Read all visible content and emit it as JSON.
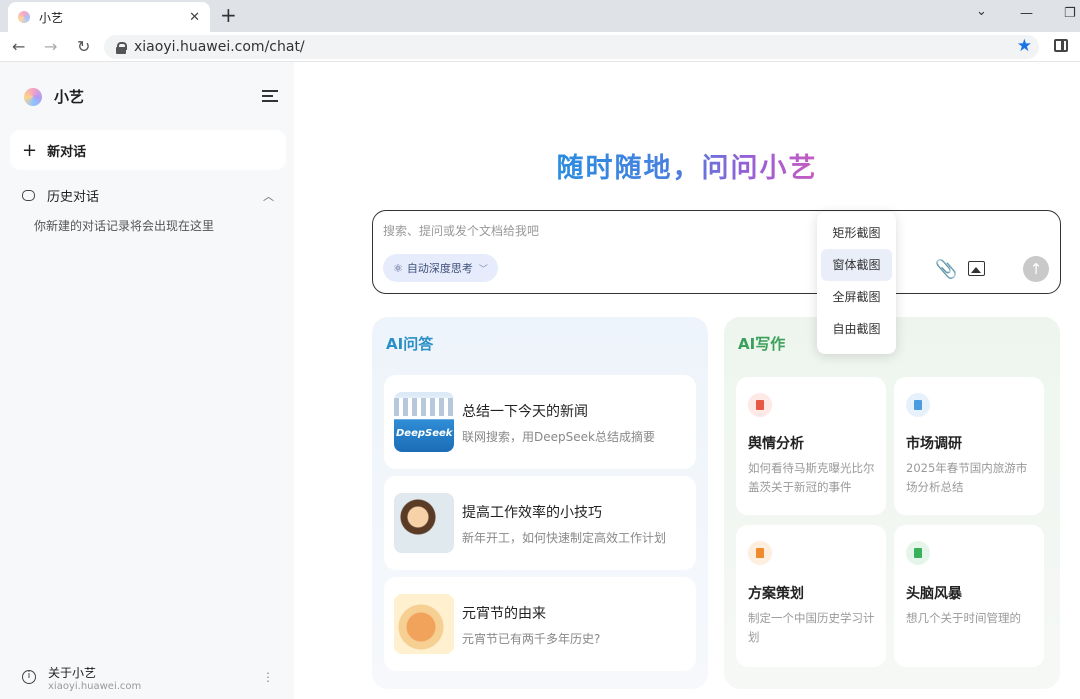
{
  "browser": {
    "tab_title": "小艺",
    "tab_close": "✕",
    "new_tab": "+",
    "url": "xiaoyi.huawei.com/chat/",
    "back": "←",
    "forward": "→",
    "reload": "↻",
    "window_dropdown": "⌄",
    "minimize": "—",
    "restore": "❐",
    "bookmark": "★"
  },
  "sidebar": {
    "brand": "小艺",
    "new_chat": "新对话",
    "history_label": "历史对话",
    "history_empty": "你新建的对话记录将会出现在这里",
    "about_title": "关于小艺",
    "about_url": "xiaoyi.huawei.com"
  },
  "main": {
    "hero": "随时随地，问问小艺",
    "input_placeholder": "搜索、提问或发个文档给我吧",
    "deep_think": "自动深度思考",
    "screenshot_menu": [
      "矩形截图",
      "窗体截图",
      "全屏截图",
      "自由截图"
    ],
    "qa": {
      "title": "AI问答",
      "cards": [
        {
          "title": "总结一下今天的新闻",
          "sub": "联网搜索，用DeepSeek总结成摘要",
          "thumb_label": "DeepSeek"
        },
        {
          "title": "提高工作效率的小技巧",
          "sub": "新年开工，如何快速制定高效工作计划"
        },
        {
          "title": "元宵节的由来",
          "sub": "元宵节已有两千多年历史?"
        }
      ]
    },
    "writing": {
      "title": "AI写作",
      "cards": [
        {
          "title": "舆情分析",
          "sub": "如何看待马斯克曝光比尔盖茨关于新冠的事件"
        },
        {
          "title": "市场调研",
          "sub": "2025年春节国内旅游市场分析总结"
        },
        {
          "title": "方案策划",
          "sub": "制定一个中国历史学习计划"
        },
        {
          "title": "头脑风暴",
          "sub": "想几个关于时间管理的"
        }
      ]
    }
  }
}
